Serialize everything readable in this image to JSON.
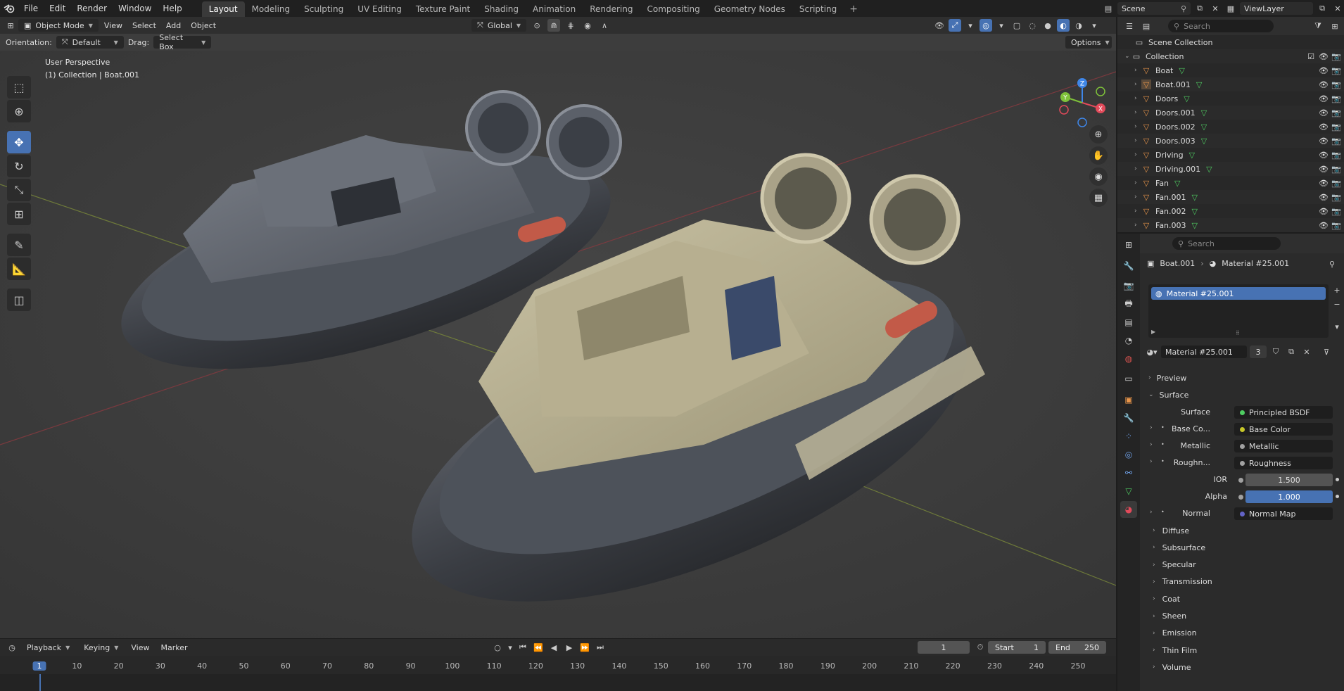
{
  "topbar": {
    "menus": [
      "File",
      "Edit",
      "Render",
      "Window",
      "Help"
    ],
    "workspaces": [
      "Layout",
      "Modeling",
      "Sculpting",
      "UV Editing",
      "Texture Paint",
      "Shading",
      "Animation",
      "Rendering",
      "Compositing",
      "Geometry Nodes",
      "Scripting"
    ],
    "active_workspace": "Layout",
    "scene": "Scene",
    "view_layer": "ViewLayer"
  },
  "viewport": {
    "mode": "Object Mode",
    "menus": [
      "View",
      "Select",
      "Add",
      "Object"
    ],
    "transform_orientation": "Global",
    "orientation_label": "Orientation:",
    "orientation_value": "Default",
    "drag_label": "Drag:",
    "drag_value": "Select Box",
    "options_label": "Options",
    "overlay_line1": "User Perspective",
    "overlay_line2": "(1) Collection | Boat.001",
    "gizmo": {
      "x": "X",
      "y": "Y",
      "z": "Z"
    }
  },
  "timeline": {
    "menus": [
      "Playback",
      "Keying",
      "View",
      "Marker"
    ],
    "current_frame": "1",
    "start_label": "Start",
    "start_value": "1",
    "end_label": "End",
    "end_value": "250",
    "ticks": [
      "1",
      "10",
      "20",
      "30",
      "40",
      "50",
      "60",
      "70",
      "80",
      "90",
      "100",
      "110",
      "120",
      "130",
      "140",
      "150",
      "160",
      "170",
      "180",
      "190",
      "200",
      "210",
      "220",
      "230",
      "240",
      "250"
    ]
  },
  "outliner": {
    "search_placeholder": "Search",
    "scene_collection": "Scene Collection",
    "collection": "Collection",
    "items": [
      "Boat",
      "Boat.001",
      "Doors",
      "Doors.001",
      "Doors.002",
      "Doors.003",
      "Driving",
      "Driving.001",
      "Fan",
      "Fan.001",
      "Fan.002",
      "Fan.003"
    ]
  },
  "properties": {
    "search_placeholder": "Search",
    "object_name": "Boat.001",
    "material_name": "Material #25.001",
    "slot_name": "Material #25.001",
    "material_field": "Material #25.001",
    "user_count": "3",
    "preview_label": "Preview",
    "surface_panel": "Surface",
    "surface_label": "Surface",
    "surface_value": "Principled BSDF",
    "inputs": [
      {
        "label": "Base Co...",
        "value": "Base Color",
        "socket_color": "#c7c729"
      },
      {
        "label": "Metallic",
        "value": "Metallic",
        "socket_color": "#a1a1a1"
      },
      {
        "label": "Roughn...",
        "value": "Roughness",
        "socket_color": "#a1a1a1"
      }
    ],
    "ior_label": "IOR",
    "ior_value": "1.500",
    "alpha_label": "Alpha",
    "alpha_value": "1.000",
    "normal_label": "Normal",
    "normal_value": "Normal Map",
    "subpanels": [
      "Diffuse",
      "Subsurface",
      "Specular",
      "Transmission",
      "Coat",
      "Sheen",
      "Emission",
      "Thin Film",
      "Volume"
    ]
  },
  "colors": {
    "accent": "#4772b3",
    "object_orange": "#e8954a",
    "mesh_green": "#4fce62",
    "axis_x": "#e24a5a",
    "axis_y": "#7fc23a",
    "axis_z": "#3f86e8"
  }
}
